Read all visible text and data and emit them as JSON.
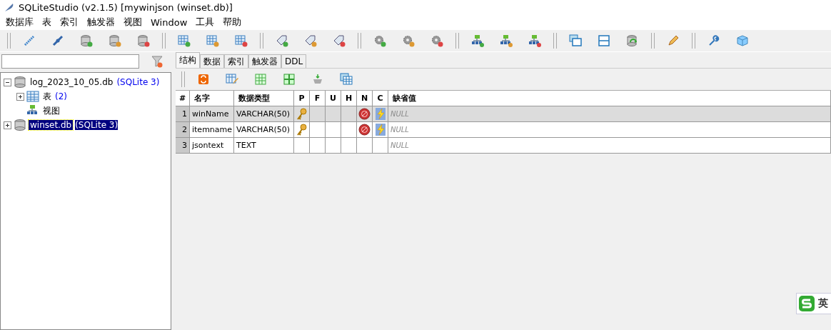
{
  "window": {
    "title": "SQLiteStudio (v2.1.5) [mywinjson (winset.db)]"
  },
  "menu": [
    "数据库",
    "表",
    "索引",
    "触发器",
    "视图",
    "Window",
    "工具",
    "帮助"
  ],
  "tree": [
    {
      "kind": "database",
      "label": "log_2023_10_05.db",
      "version": "(SQLite 3)",
      "expanded": true,
      "selected": false,
      "children": [
        {
          "kind": "tables",
          "label": "表",
          "count": "(2)",
          "expanded": false,
          "selected": false
        },
        {
          "kind": "views",
          "label": "视图",
          "selected": false
        }
      ]
    },
    {
      "kind": "database",
      "label": "winset.db",
      "version": "(SQLite 3)",
      "expanded": false,
      "selected": true
    }
  ],
  "tabs": [
    {
      "label": "结构",
      "selected": true
    },
    {
      "label": "数据",
      "selected": false
    },
    {
      "label": "索引",
      "selected": false
    },
    {
      "label": "触发器",
      "selected": false
    },
    {
      "label": "DDL",
      "selected": false
    }
  ],
  "table": {
    "columns": [
      "#",
      "名字",
      "数据类型",
      "P",
      "F",
      "U",
      "H",
      "N",
      "C",
      "缺省值"
    ],
    "rows": [
      {
        "index": "1",
        "name": "winName",
        "type": "VARCHAR(50)",
        "primary_key": true,
        "not_null": true,
        "check": true,
        "default": "NULL",
        "selected": true
      },
      {
        "index": "2",
        "name": "itemname",
        "type": "VARCHAR(50)",
        "primary_key": true,
        "not_null": true,
        "check": true,
        "default": "NULL",
        "selected": false
      },
      {
        "index": "3",
        "name": "jsontext",
        "type": "TEXT",
        "primary_key": false,
        "not_null": false,
        "check": false,
        "default": "NULL",
        "selected": false
      }
    ]
  },
  "ime_indicator": {
    "label": "英"
  }
}
